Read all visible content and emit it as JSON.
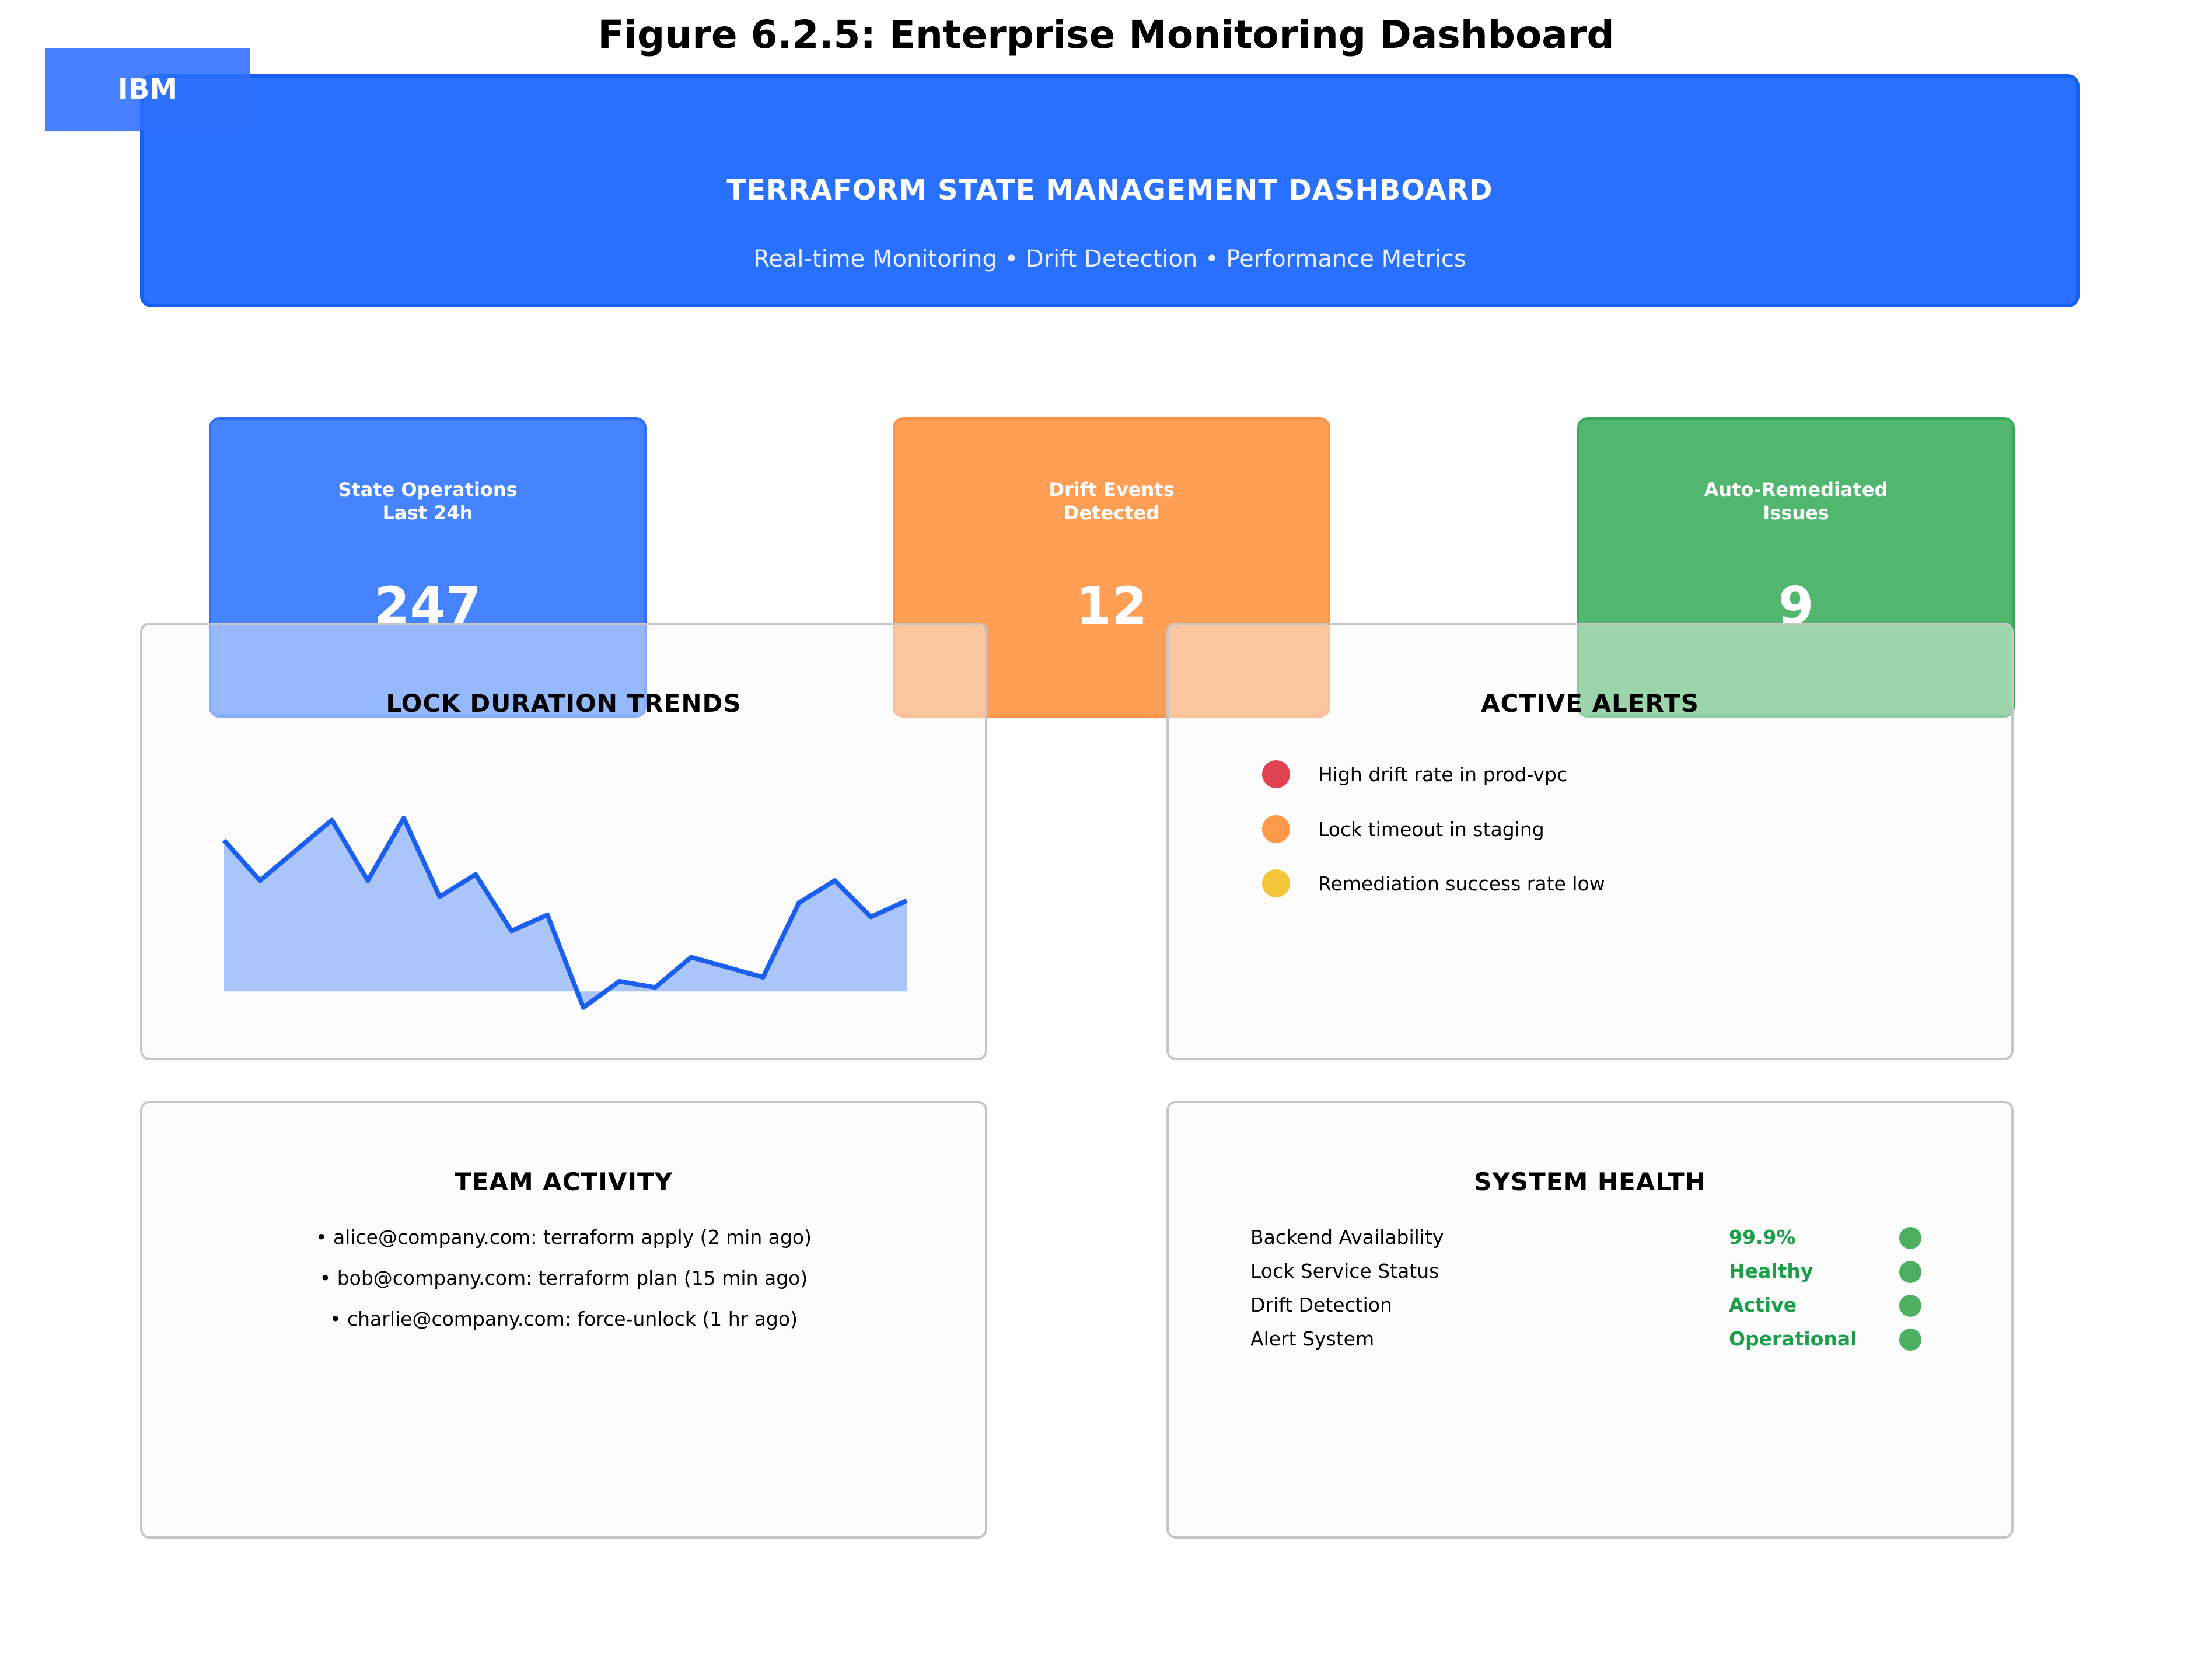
{
  "figure": {
    "title": "Figure 6.2.5: Enterprise Monitoring Dashboard"
  },
  "logo": {
    "text": "IBM",
    "color": "#2d6eff"
  },
  "header": {
    "title": "TERRAFORM STATE MANAGEMENT DASHBOARD",
    "subtitle": "Real-time Monitoring • Drift Detection • Performance Metrics",
    "color": "#2970ff"
  },
  "kpis": [
    {
      "label": "State Operations\nLast 24h",
      "value": "247",
      "color": "#2d6eff"
    },
    {
      "label": "Drift Events\nDetected",
      "value": "12",
      "color": "#ff8c33"
    },
    {
      "label": "Auto-Remediated\nIssues",
      "value": "9",
      "color": "#35a853"
    }
  ],
  "lock_trends": {
    "title": "LOCK DURATION TRENDS",
    "line_color": "#1a5ff0",
    "fill_color": "#aac5fa",
    "chart_data": {
      "type": "area",
      "x": [
        1,
        2,
        3,
        4,
        5,
        6,
        7,
        8,
        9,
        10,
        11,
        12,
        13,
        14,
        15,
        16,
        17,
        18,
        19,
        20
      ],
      "values": [
        7.5,
        5.5,
        7.0,
        8.5,
        5.5,
        8.6,
        4.7,
        5.8,
        3.0,
        3.8,
        -0.8,
        0.5,
        0.2,
        1.7,
        1.2,
        0.7,
        4.4,
        5.5,
        3.7,
        4.5
      ],
      "baseline": 0,
      "ylim": [
        -1.5,
        9.5
      ]
    }
  },
  "alerts": {
    "title": "ACTIVE ALERTS",
    "items": [
      {
        "text": "High drift rate in prod-vpc",
        "color": "#e0434f"
      },
      {
        "text": "Lock timeout in staging",
        "color": "#ff9a4d"
      },
      {
        "text": "Remediation success rate low",
        "color": "#f4c73a"
      }
    ]
  },
  "team_activity": {
    "title": "TEAM ACTIVITY",
    "items": [
      "• alice@company.com: terraform apply (2 min ago)",
      "• bob@company.com: terraform plan (15 min ago)",
      "• charlie@company.com: force-unlock (1 hr ago)"
    ]
  },
  "system_health": {
    "title": "SYSTEM HEALTH",
    "status_color": "#1a9e48",
    "rows": [
      {
        "label": "Backend Availability",
        "value": "99.9%"
      },
      {
        "label": "Lock Service Status",
        "value": "Healthy"
      },
      {
        "label": "Drift Detection",
        "value": "Active"
      },
      {
        "label": "Alert System",
        "value": "Operational"
      }
    ]
  }
}
